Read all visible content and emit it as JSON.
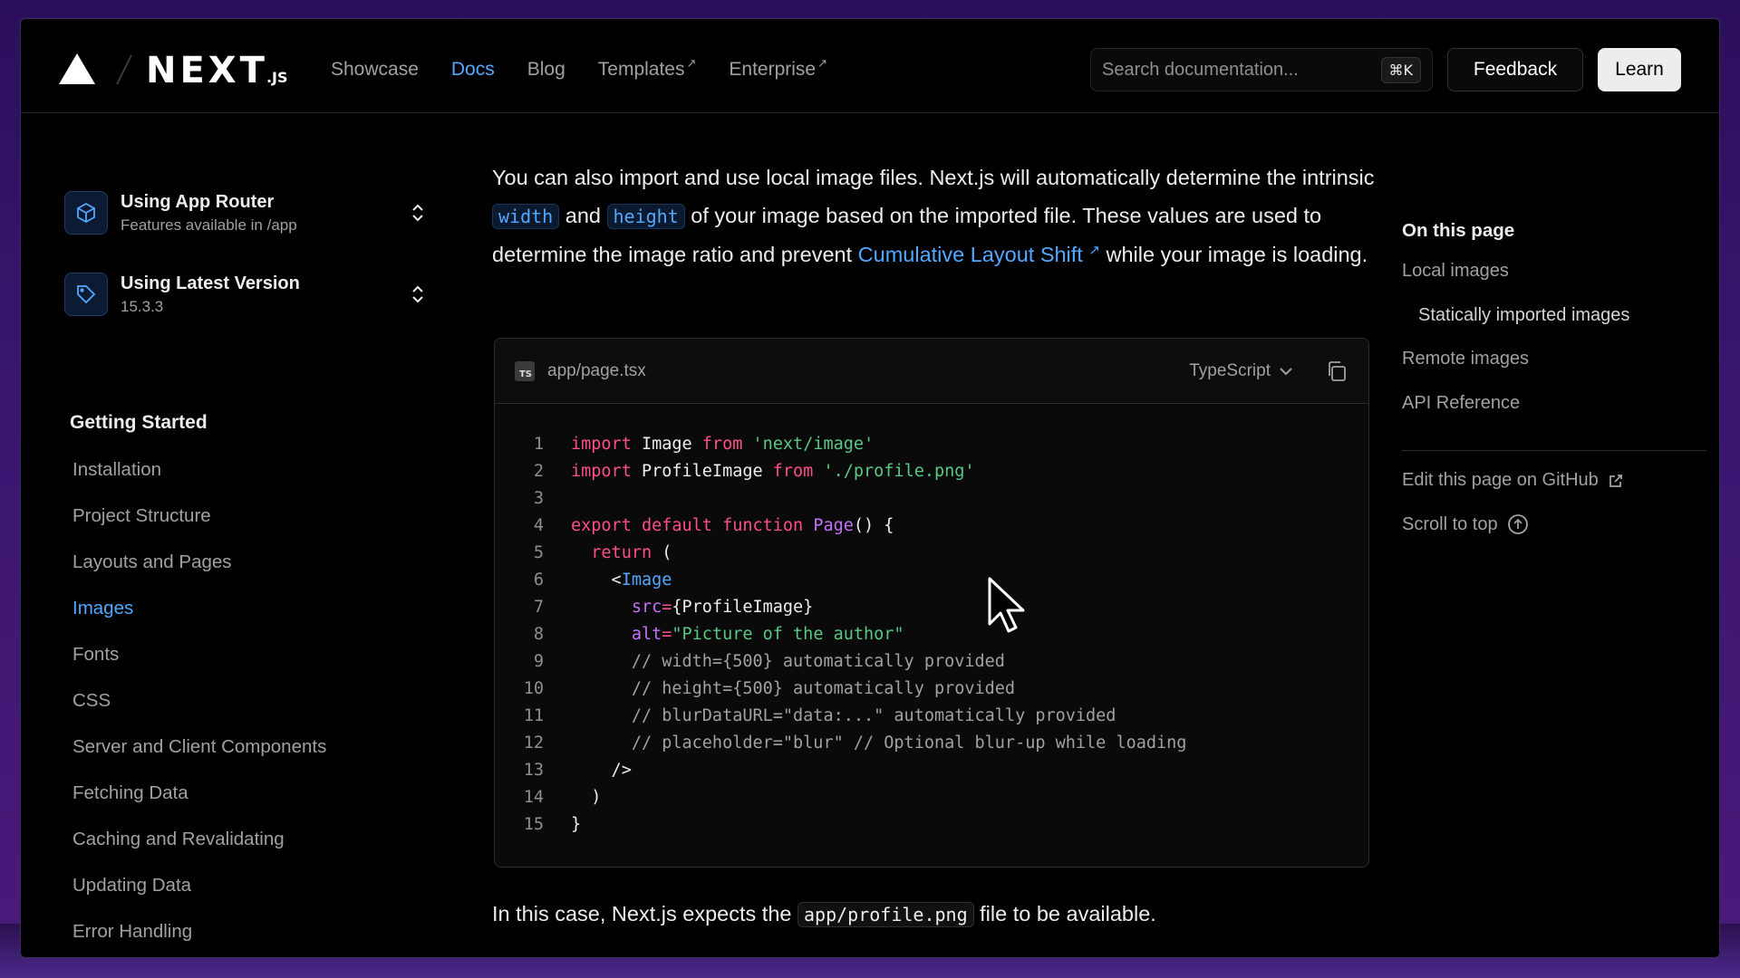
{
  "header": {
    "logo_word": "NEXT",
    "logo_suffix": ".JS",
    "nav": [
      {
        "label": "Showcase",
        "external": false,
        "active": false
      },
      {
        "label": "Docs",
        "external": false,
        "active": true
      },
      {
        "label": "Blog",
        "external": false,
        "active": false
      },
      {
        "label": "Templates",
        "external": true,
        "active": false
      },
      {
        "label": "Enterprise",
        "external": true,
        "active": false
      }
    ],
    "search_placeholder": "Search documentation...",
    "search_shortcut": "⌘K",
    "feedback_label": "Feedback",
    "learn_label": "Learn"
  },
  "sidebar": {
    "router": {
      "title": "Using App Router",
      "subtitle": "Features available in /app"
    },
    "version": {
      "title": "Using Latest Version",
      "subtitle": "15.3.3"
    },
    "section_title": "Getting Started",
    "items": [
      {
        "label": "Installation",
        "active": false
      },
      {
        "label": "Project Structure",
        "active": false
      },
      {
        "label": "Layouts and Pages",
        "active": false
      },
      {
        "label": "Images",
        "active": true
      },
      {
        "label": "Fonts",
        "active": false
      },
      {
        "label": "CSS",
        "active": false
      },
      {
        "label": "Server and Client Components",
        "active": false
      },
      {
        "label": "Fetching Data",
        "active": false
      },
      {
        "label": "Caching and Revalidating",
        "active": false
      },
      {
        "label": "Updating Data",
        "active": false
      },
      {
        "label": "Error Handling",
        "active": false
      }
    ]
  },
  "main": {
    "para": {
      "t1": "You can also import and use local image files. Next.js will automatically determine the intrinsic ",
      "code1": "width",
      "t2": " and ",
      "code2": "height",
      "t3": " of your image based on the imported file. These values are used to determine the image ratio and prevent ",
      "link": "Cumulative Layout Shift",
      "t4": " while your image is loading."
    },
    "codeblock": {
      "filename": "app/page.tsx",
      "language": "TypeScript",
      "lines": [
        [
          {
            "t": "import",
            "c": "kw"
          },
          {
            "t": " Image ",
            "c": ""
          },
          {
            "t": "from",
            "c": "kw"
          },
          {
            "t": " ",
            "c": ""
          },
          {
            "t": "'next/image'",
            "c": "str"
          }
        ],
        [
          {
            "t": "import",
            "c": "kw"
          },
          {
            "t": " ProfileImage ",
            "c": ""
          },
          {
            "t": "from",
            "c": "kw"
          },
          {
            "t": " ",
            "c": ""
          },
          {
            "t": "'./profile.png'",
            "c": "str"
          }
        ],
        [],
        [
          {
            "t": "export",
            "c": "kw"
          },
          {
            "t": " ",
            "c": ""
          },
          {
            "t": "default",
            "c": "kw"
          },
          {
            "t": " ",
            "c": ""
          },
          {
            "t": "function",
            "c": "kw"
          },
          {
            "t": " ",
            "c": ""
          },
          {
            "t": "Page",
            "c": "fn"
          },
          {
            "t": "() {",
            "c": ""
          }
        ],
        [
          {
            "t": "  ",
            "c": ""
          },
          {
            "t": "return",
            "c": "kw"
          },
          {
            "t": " (",
            "c": ""
          }
        ],
        [
          {
            "t": "    <",
            "c": ""
          },
          {
            "t": "Image",
            "c": "tag"
          }
        ],
        [
          {
            "t": "      ",
            "c": ""
          },
          {
            "t": "src",
            "c": "attr"
          },
          {
            "t": "=",
            "c": "kw"
          },
          {
            "t": "{ProfileImage}",
            "c": ""
          }
        ],
        [
          {
            "t": "      ",
            "c": ""
          },
          {
            "t": "alt",
            "c": "attr"
          },
          {
            "t": "=",
            "c": "kw"
          },
          {
            "t": "\"Picture of the author\"",
            "c": "str"
          }
        ],
        [
          {
            "t": "      // width={500} automatically provided",
            "c": "cm"
          }
        ],
        [
          {
            "t": "      // height={500} automatically provided",
            "c": "cm"
          }
        ],
        [
          {
            "t": "      // blurDataURL=\"data:...\" automatically provided",
            "c": "cm"
          }
        ],
        [
          {
            "t": "      // placeholder=\"blur\" // Optional blur-up while loading",
            "c": "cm"
          }
        ],
        [
          {
            "t": "    />",
            "c": ""
          }
        ],
        [
          {
            "t": "  )",
            "c": ""
          }
        ],
        [
          {
            "t": "}",
            "c": ""
          }
        ]
      ]
    },
    "para2": {
      "t1": "In this case, Next.js expects the ",
      "code": "app/profile.png",
      "t2": " file to be available."
    }
  },
  "toc": {
    "title": "On this page",
    "items": [
      {
        "label": "Local images",
        "sub": false
      },
      {
        "label": "Statically imported images",
        "sub": true
      },
      {
        "label": "Remote images",
        "sub": false
      },
      {
        "label": "API Reference",
        "sub": false
      }
    ],
    "edit_label": "Edit this page on GitHub",
    "scroll_label": "Scroll to top"
  },
  "colors": {
    "accent": "#52a8ff",
    "background": "#000000",
    "frame": "#3a1670"
  }
}
